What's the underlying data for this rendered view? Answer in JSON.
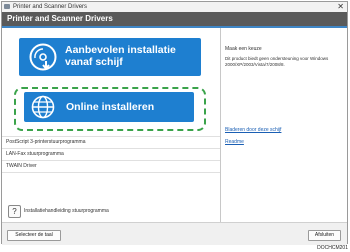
{
  "window": {
    "title": "Printer and Scanner Drivers",
    "close_glyph": "✕"
  },
  "header": {
    "title": "Printer and Scanner Drivers"
  },
  "main": {
    "recommended_button": {
      "label": "Aanbevolen installatie vanaf schijf",
      "icon": "disc-install-icon"
    },
    "online_button": {
      "label": "Online installeren",
      "icon": "globe-icon"
    },
    "highlight_color": "#3aa34a",
    "button_color": "#1e7fd0",
    "drivers": [
      "PostScript 3-printerstuurprogramma",
      "LAN-Fax stuurprogramma",
      "TWAIN Driver"
    ],
    "help": {
      "icon_glyph": "?",
      "label": "Installatiehandleiding stuurprogramma"
    }
  },
  "info": {
    "title": "Maak een keuze",
    "description": "Dit product biedt geen ondersteuning voor Windows 2000/XP/2003/Vista/7/2008/8.",
    "links": [
      "Bladeren door deze schijf",
      "Readme"
    ]
  },
  "footer": {
    "language_button": "Selecteer de taal",
    "cancel_button": "Afsluiten"
  },
  "doc_id": "DOCHCM201"
}
